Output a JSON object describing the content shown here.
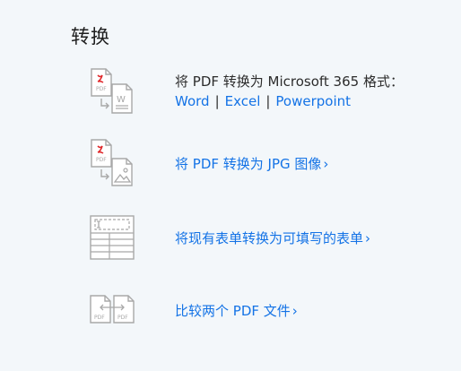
{
  "section": {
    "title": "转换"
  },
  "items": [
    {
      "icon": "pdf-to-word-icon",
      "line1": "将 PDF 转换为 Microsoft 365 格式：",
      "links": [
        "Word",
        "Excel",
        "Powerpoint"
      ],
      "separator": "|"
    },
    {
      "icon": "pdf-to-image-icon",
      "label": "将 PDF 转换为 JPG 图像",
      "chevron": "›"
    },
    {
      "icon": "fillable-form-icon",
      "label": "将现有表单转换为可填写的表单",
      "chevron": "›"
    },
    {
      "icon": "compare-pdf-icon",
      "label": "比较两个 PDF 文件",
      "chevron": "›"
    }
  ],
  "icon_text": {
    "pdf": "PDF",
    "word_letter": "W"
  },
  "colors": {
    "background": "#f3f7fa",
    "link": "#1473e6",
    "text": "#2c2c2c",
    "icon_gray": "#a8a8a8",
    "pdf_red": "#e0272a"
  }
}
